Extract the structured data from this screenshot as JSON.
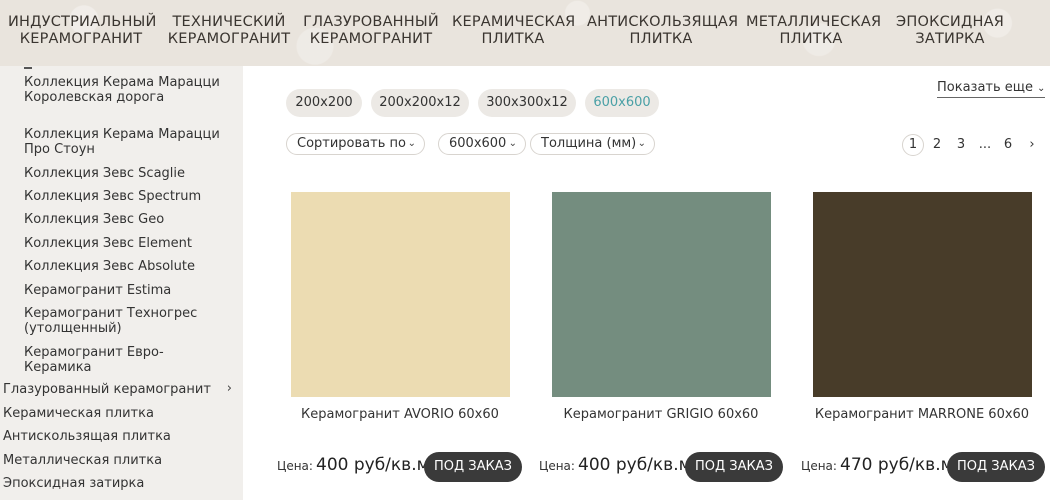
{
  "topnav": [
    {
      "label": "Индустриальный керамогранит"
    },
    {
      "label": "Технический керамогранит"
    },
    {
      "label": "Глазурованный керамогранит"
    },
    {
      "label": "Керамическая плитка"
    },
    {
      "label": "Антискользящая плитка"
    },
    {
      "label": "Металлическая плитка"
    },
    {
      "label": "Эпоксидная затирка"
    }
  ],
  "sidebar": {
    "subitems": [
      {
        "label": "Коллекция Керама Марацци Королевская дорога"
      },
      {
        "label": "Коллекция Керама Марацци Про Стоун"
      },
      {
        "label": "Коллекция Зевс Scaglie"
      },
      {
        "label": "Коллекция Зевс Spectrum"
      },
      {
        "label": "Коллекция Зевс Geo"
      },
      {
        "label": "Коллекция Зевс Element"
      },
      {
        "label": "Коллекция Зевс Absolute"
      },
      {
        "label": "Керамогранит Estima"
      },
      {
        "label": "Керамогранит Техногрес (утолщенный)"
      },
      {
        "label": "Керамогранит Евро-Керамика"
      }
    ],
    "categories": [
      {
        "label": "Глазурованный керамогранит",
        "has_children": true
      },
      {
        "label": "Керамическая плитка"
      },
      {
        "label": "Антискользящая плитка"
      },
      {
        "label": "Металлическая плитка"
      },
      {
        "label": "Эпоксидная затирка"
      }
    ]
  },
  "size_chips": [
    {
      "label": "200x200",
      "active": false
    },
    {
      "label": "200x200x12",
      "active": false
    },
    {
      "label": "300x300x12",
      "active": false
    },
    {
      "label": "600x600",
      "active": true
    }
  ],
  "show_more_label": "Показать еще",
  "filters": {
    "sort_label": "Сортировать по",
    "size_label": "600x600",
    "thickness_label": "Толщина (мм)"
  },
  "pagination": {
    "pages": [
      "1",
      "2",
      "3",
      "...",
      "6"
    ],
    "current": "1",
    "next_icon": "chevron-right-icon"
  },
  "products": [
    {
      "name": "Керамогранит AVORIO 60x60",
      "price_label": "Цена:",
      "price": "400 руб/кв.м",
      "button": "ПОД ЗАКАЗ",
      "color": "#ecdcb2"
    },
    {
      "name": "Керамогранит GRIGIO 60x60",
      "price_label": "Цена:",
      "price": "400 руб/кв.м",
      "button": "ПОД ЗАКАЗ",
      "color": "#748d7f"
    },
    {
      "name": "Керамогранит MARRONE 60x60",
      "price_label": "Цена:",
      "price": "470 руб/кв.м",
      "button": "ПОД ЗАКАЗ",
      "color": "#483c29"
    }
  ],
  "colors": {
    "accent": "#4aa0a6",
    "button_bg": "#3a3a3a",
    "sidebar_bg": "#f1efec",
    "nav_bg": "#e9e4dd"
  }
}
